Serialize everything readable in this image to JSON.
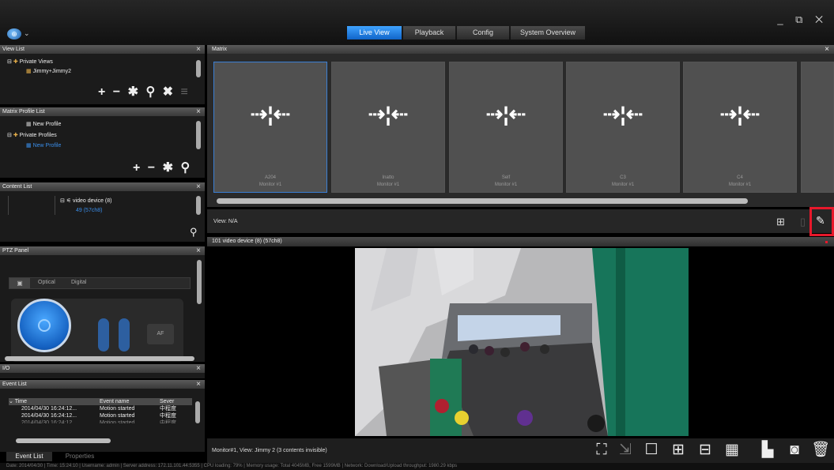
{
  "topnav": {
    "items": [
      "Live View",
      "Playback",
      "Config",
      "System Overview"
    ],
    "active": 0
  },
  "view_list": {
    "title": "View List",
    "tree": [
      "Private Views",
      "Jimmy+Jimmy2"
    ],
    "tools": [
      "+",
      "−",
      "✱",
      "⚲",
      "✖",
      "≡"
    ]
  },
  "matrix_profile_list": {
    "title": "Matrix Profile List",
    "tree": [
      "New Profile",
      "Private Profiles",
      "New Profile"
    ],
    "tools": [
      "+",
      "−",
      "✱",
      "⚲"
    ]
  },
  "content_list": {
    "title": "Content List",
    "tree": [
      "video device (8)",
      "49 (57ch8)"
    ]
  },
  "ptz_panel": {
    "title": "PTZ Panel",
    "tabs": [
      "Optical",
      "Digital"
    ],
    "af": "AF"
  },
  "io_panel": {
    "title": "I/O"
  },
  "event_list": {
    "title": "Event List",
    "columns": [
      "Time",
      "Event name",
      "Sever"
    ],
    "rows": [
      [
        "2014/04/30  16:24:12...",
        "Motion started",
        "中程度"
      ],
      [
        "2014/04/30  16:24:12...",
        "Motion started",
        "中程度"
      ],
      [
        "2014/04/30  16:24:12...",
        "Motion started",
        "中程度"
      ]
    ],
    "bottom_tabs": [
      "Event List",
      "Properties"
    ]
  },
  "matrix": {
    "title": "Matrix",
    "tiles": [
      {
        "name": "A204",
        "monitor": "Monitor #1"
      },
      {
        "name": "Inatto",
        "monitor": "Monitor #1"
      },
      {
        "name": "Self",
        "monitor": "Monitor #1"
      },
      {
        "name": "C3",
        "monitor": "Monitor #1"
      },
      {
        "name": "C4",
        "monitor": "Monitor #1"
      }
    ],
    "view_label": "View: N/A"
  },
  "video": {
    "title": "101  video device (8)  (57ch8)",
    "status": "Monitor#1, View: Jimmy 2 (3 contents invisible)"
  },
  "statusbar": "Date: 2014/04/30  |  Time: 15:24:10  |  Username: admin  |  Server address: 172.11.101.44:5355  |  CPU loading: 79%  |  Memory usage: Total 4045MB, Free 1599MB  |  Network: Download/Upload throughput: 1980.29 kbps",
  "colors": {
    "accent": "#1e7be0",
    "highlight": "#e8182b",
    "video_bg": "#000000"
  }
}
